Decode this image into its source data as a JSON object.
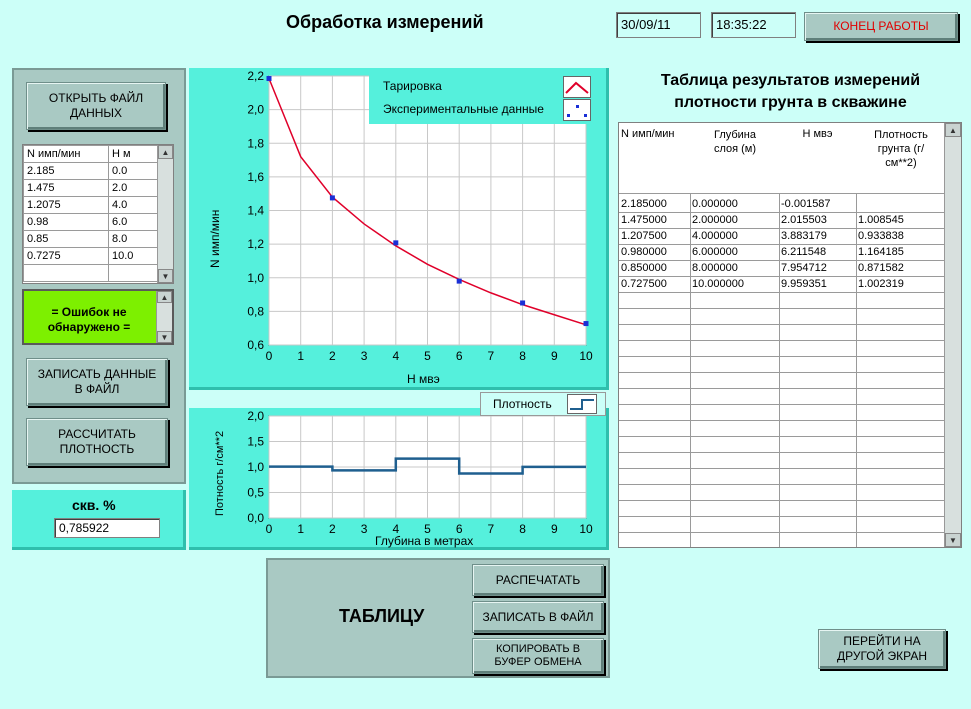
{
  "header": {
    "title": "Обработка измерений",
    "date": "30/09/11",
    "time": "18:35:22",
    "exit_label": "КОНЕЦ РАБОТЫ"
  },
  "left": {
    "open_file_label": "ОТКРЫТЬ ФАЙЛ ДАННЫХ",
    "input_table": {
      "headers": [
        "N имп/мин",
        "Н м"
      ],
      "rows": [
        [
          "2.185",
          "0.0"
        ],
        [
          "1.475",
          "2.0"
        ],
        [
          "1.2075",
          "4.0"
        ],
        [
          "0.98",
          "6.0"
        ],
        [
          "0.85",
          "8.0"
        ],
        [
          "0.7275",
          "10.0"
        ],
        [
          "",
          ""
        ]
      ]
    },
    "status_text": "= Ошибок не обнаружено =",
    "write_data_label": "ЗАПИСАТЬ ДАННЫЕ В ФАЙЛ",
    "calc_density_label": "РАССЧИТАТЬ ПЛОТНОСТЬ",
    "skv_label": "скв. %",
    "skv_value": "0,785922"
  },
  "chart_top": {
    "legend": [
      "Тарировка",
      "Экспериментальные данные"
    ],
    "xlabel": "Н мвэ",
    "ylabel": "N имп/мин",
    "xticks": [
      "0",
      "1",
      "2",
      "3",
      "4",
      "5",
      "6",
      "7",
      "8",
      "9",
      "10"
    ],
    "yticks": [
      "0,6",
      "0,8",
      "1,0",
      "1,2",
      "1,4",
      "1,6",
      "1,8",
      "2,0",
      "2,2"
    ]
  },
  "chart_bottom": {
    "legend": "Плотность",
    "xlabel": "Глубина в метрах",
    "ylabel": "Потность г/см**2",
    "xticks": [
      "0",
      "1",
      "2",
      "3",
      "4",
      "5",
      "6",
      "7",
      "8",
      "9",
      "10"
    ],
    "yticks": [
      "0,0",
      "0,5",
      "1,0",
      "1,5",
      "2,0"
    ]
  },
  "chart_data": [
    {
      "type": "line",
      "xlabel": "Н мвэ",
      "ylabel": "N имп/мин",
      "xlim": [
        0,
        10
      ],
      "ylim": [
        0.6,
        2.2
      ],
      "grid": true,
      "legend_position": "top-right",
      "series": [
        {
          "name": "Тарировка",
          "x": [
            0,
            1,
            2,
            3,
            4,
            5,
            6,
            7,
            8,
            9,
            10
          ],
          "y": [
            2.185,
            1.72,
            1.48,
            1.32,
            1.19,
            1.08,
            0.99,
            0.91,
            0.84,
            0.78,
            0.72
          ],
          "color": "#e0002a"
        },
        {
          "name": "Экспериментальные данные",
          "x": [
            0,
            2,
            4,
            6,
            8,
            10
          ],
          "y": [
            2.185,
            1.475,
            1.2075,
            0.98,
            0.85,
            0.7275
          ],
          "color": "#1a2fd6",
          "style": "points"
        }
      ]
    },
    {
      "type": "line",
      "xlabel": "Глубина в метрах",
      "ylabel": "Потность г/см**2",
      "xlim": [
        0,
        10
      ],
      "ylim": [
        0,
        2
      ],
      "grid": true,
      "legend_position": "top-right",
      "series": [
        {
          "name": "Плотность",
          "step_x": [
            0,
            2,
            4,
            6,
            8,
            10
          ],
          "values": [
            1.008545,
            0.933838,
            1.164185,
            0.871582,
            1.002319
          ],
          "color": "#1f5f8f"
        }
      ]
    }
  ],
  "results": {
    "title_line1": "Таблица результатов измерений",
    "title_line2": "плотности грунта в скважине",
    "headers": [
      "N имп/мин",
      "Глубина слоя (м)",
      "Н мвэ",
      "Плотность грунта (г/см**2)"
    ],
    "rows": [
      [
        "2.185000",
        "0.000000",
        "-0.001587",
        ""
      ],
      [
        "1.475000",
        "2.000000",
        "2.015503",
        "1.008545"
      ],
      [
        "1.207500",
        "4.000000",
        "3.883179",
        "0.933838"
      ],
      [
        "0.980000",
        "6.000000",
        "6.211548",
        "1.164185"
      ],
      [
        "0.850000",
        "8.000000",
        "7.954712",
        "0.871582"
      ],
      [
        "0.727500",
        "10.000000",
        "9.959351",
        "1.002319"
      ]
    ]
  },
  "bottom": {
    "table_label": "ТАБЛИЦУ",
    "print_label": "РАСПЕЧАТАТЬ",
    "write_file_label": "ЗАПИСАТЬ В ФАЙЛ",
    "copy_label": "КОПИРОВАТЬ В БУФЕР ОБМЕНА",
    "goto_label": "ПЕРЕЙТИ НА ДРУГОЙ ЭКРАН"
  },
  "colors": {
    "bg": "#ccfff8",
    "panel_cyan": "#55f0dc",
    "status_green": "#7df000",
    "calibration_red": "#e0002a",
    "points_blue": "#1a2fd6",
    "density_line": "#1f5f8f"
  }
}
